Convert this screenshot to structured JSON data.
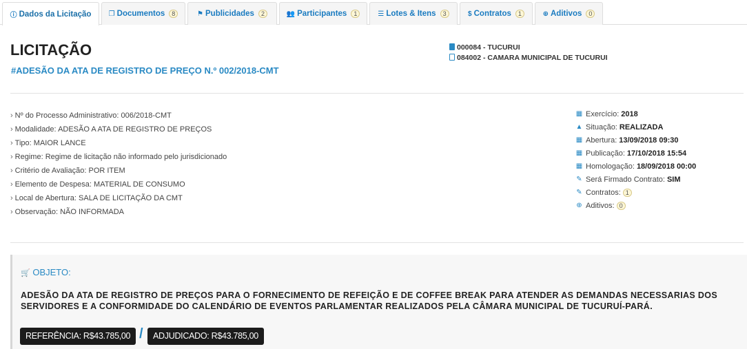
{
  "tabs": [
    {
      "label": "Dados da Licitação",
      "icon": "info-icon",
      "badge": null
    },
    {
      "label": "Documentos",
      "icon": "documents-icon",
      "badge": "8"
    },
    {
      "label": "Publicidades",
      "icon": "flag-icon",
      "badge": "2"
    },
    {
      "label": "Participantes",
      "icon": "users-icon",
      "badge": "1"
    },
    {
      "label": "Lotes & Itens",
      "icon": "list-icon",
      "badge": "3"
    },
    {
      "label": "Contratos",
      "icon": "dollar-icon",
      "badge": "1"
    },
    {
      "label": "Aditivos",
      "icon": "plus-circle-icon",
      "badge": "0"
    }
  ],
  "header": {
    "title": "LICITAÇÃO",
    "subtitle": "#ADESÃO DA ATA DE REGISTRO DE PREÇO N.º 002/2018-CMT",
    "entity1": "000084 - TUCURUI",
    "entity2": "084002 - CAMARA MUNICIPAL DE TUCURUI"
  },
  "details_left": [
    {
      "label": "Nº do Processo Administrativo:",
      "value": "006/2018-CMT"
    },
    {
      "label": "Modalidade:",
      "value": "ADESÃO A ATA DE REGISTRO DE PREÇOS"
    },
    {
      "label": "Tipo:",
      "value": "MAIOR LANCE"
    },
    {
      "label": "Regime:",
      "value": "Regime de licitação não informado pelo jurisdicionado"
    },
    {
      "label": "Critério de Avaliação:",
      "value": "POR ITEM"
    },
    {
      "label": "Elemento de Despesa:",
      "value": "MATERIAL DE CONSUMO"
    },
    {
      "label": "Local de Abertura:",
      "value": "SALA DE LICITAÇÃO DA CMT"
    },
    {
      "label": "Observação:",
      "value": "NÃO INFORMADA"
    }
  ],
  "details_right": [
    {
      "icon": "calendar-icon",
      "label": "Exercício:",
      "value": "2018"
    },
    {
      "icon": "warning-icon",
      "label": "Situação:",
      "value": "REALIZADA"
    },
    {
      "icon": "calendar-icon",
      "label": "Abertura:",
      "value": "13/09/2018 09:30"
    },
    {
      "icon": "calendar-icon",
      "label": "Publicação:",
      "value": "17/10/2018 15:54"
    },
    {
      "icon": "calendar-icon",
      "label": "Homologação:",
      "value": "18/09/2018 00:00"
    },
    {
      "icon": "edit-icon",
      "label": "Será Firmado Contrato:",
      "value": "SIM"
    },
    {
      "icon": "edit-icon",
      "label": "Contratos:",
      "badge": "1"
    },
    {
      "icon": "plus-circle-icon",
      "label": "Aditivos:",
      "badge": "0"
    }
  ],
  "objeto": {
    "label": "OBJETO:",
    "text": "ADESÃO DA ATA DE REGISTRO DE PREÇOS PARA O FORNECIMENTO DE REFEIÇÃO E DE COFFEE BREAK PARA ATENDER AS DEMANDAS NECESSARIAS DOS SERVIDORES E A CONFORMIDADE DO CALENDÁRIO DE EVENTOS PARLAMENTAR REALIZADOS PELA CÂMARA MUNICIPAL DE TUCURUÍ-PARÁ.",
    "referencia": "REFERÊNCIA: R$43.785,00",
    "separator": "/",
    "adjudicado": "ADJUDICADO: R$43.785,00"
  },
  "colors": {
    "accent": "#2a8ac4",
    "badge_bg": "#fdf7d7",
    "pill_bg": "#1c1c1c"
  }
}
